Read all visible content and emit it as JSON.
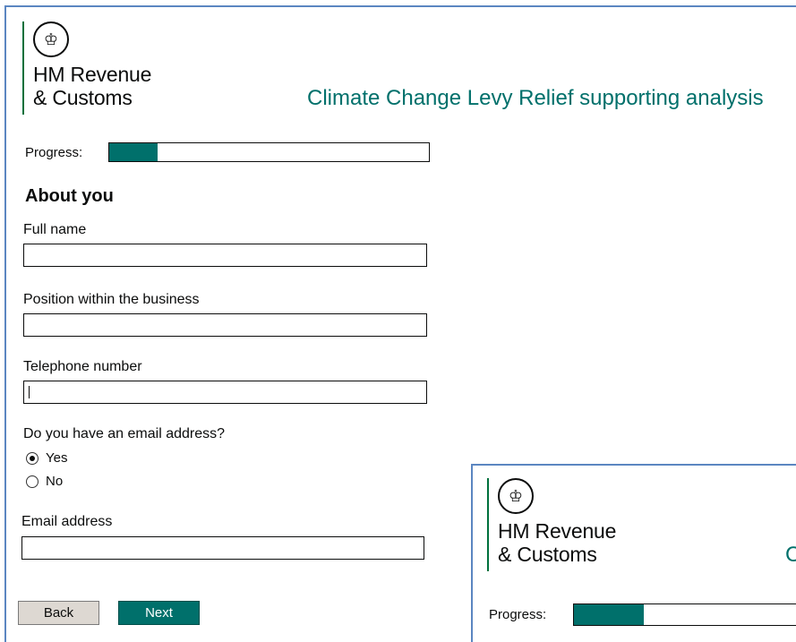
{
  "main": {
    "brand": {
      "line1": "HM Revenue",
      "line2": "& Customs",
      "crest_icon": "crown-crest-icon"
    },
    "service_title": "Climate Change Levy Relief supporting analysis",
    "progress": {
      "label": "Progress:",
      "value": 0.15
    },
    "heading": "About you",
    "fields": {
      "full_name": {
        "label": "Full name",
        "value": ""
      },
      "position": {
        "label": "Position within the business",
        "value": ""
      },
      "telephone": {
        "label": "Telephone number",
        "value": ""
      },
      "email_question": {
        "label": "Do you have an email address?",
        "options": [
          "Yes",
          "No"
        ],
        "selected": "Yes"
      },
      "email": {
        "label": "Email address",
        "value": ""
      }
    },
    "buttons": {
      "back": "Back",
      "next": "Next"
    }
  },
  "overlay_window": {
    "brand": {
      "line1": "HM Revenue",
      "line2": "& Customs"
    },
    "service_title_partial": "C",
    "progress": {
      "label": "Progress:",
      "value": 0.3
    }
  },
  "colors": {
    "accent": "#00706b",
    "brand_line": "#00703c",
    "window_border": "#5b86c1",
    "back_button": "#ddd8d2"
  }
}
